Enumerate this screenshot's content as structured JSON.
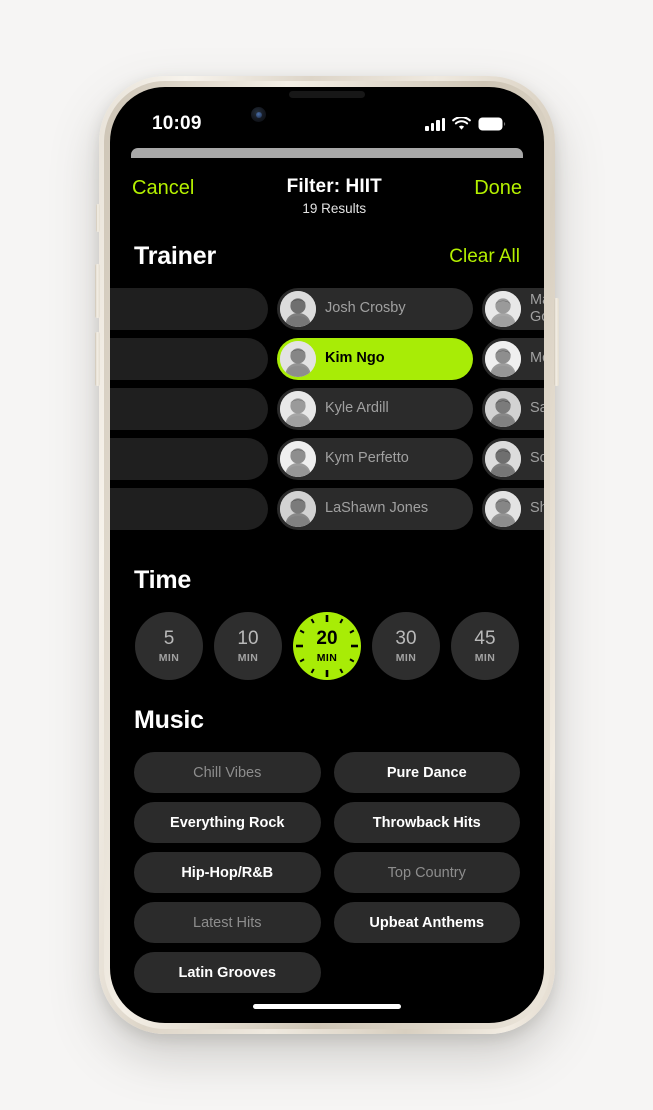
{
  "background_color": "#f6f5f4",
  "accent_color": "#a8ec06",
  "link_color": "#b4f000",
  "status_bar": {
    "time": "10:09",
    "cellular_icon": "cellular-signal-icon",
    "wifi_icon": "wifi-icon",
    "battery_icon": "battery-full-icon"
  },
  "nav": {
    "cancel_label": "Cancel",
    "title": "Filter: HIIT",
    "subtitle": "19 Results",
    "done_label": "Done"
  },
  "trainer": {
    "heading": "Trainer",
    "clear_all_label": "Clear All",
    "chips": [
      {
        "name": "",
        "selected": false,
        "ghost": true
      },
      {
        "name": "Josh Crosby",
        "selected": false,
        "ghost": false
      },
      {
        "name": "Marimba\nGold-Watts",
        "selected": false,
        "ghost": false
      },
      {
        "name": "",
        "selected": false,
        "ghost": true
      },
      {
        "name": "Kim Ngo",
        "selected": true,
        "ghost": false
      },
      {
        "name": "Molly Fox",
        "selected": false,
        "ghost": false
      },
      {
        "name": "",
        "selected": false,
        "ghost": true
      },
      {
        "name": "Kyle Ardill",
        "selected": false,
        "ghost": false
      },
      {
        "name": "Sam Sanchez",
        "selected": false,
        "ghost": false
      },
      {
        "name": "",
        "selected": false,
        "ghost": true
      },
      {
        "name": "Kym Perfetto",
        "selected": false,
        "ghost": false
      },
      {
        "name": "Scott Carvin",
        "selected": false,
        "ghost": false
      },
      {
        "name": "",
        "selected": false,
        "ghost": true
      },
      {
        "name": "LaShawn Jones",
        "selected": false,
        "ghost": false
      },
      {
        "name": "Sherica Holmon",
        "selected": false,
        "ghost": false
      }
    ]
  },
  "time": {
    "heading": "Time",
    "unit_label": "MIN",
    "options": [
      {
        "value": "5",
        "unit": "MIN",
        "selected": false
      },
      {
        "value": "10",
        "unit": "MIN",
        "selected": false
      },
      {
        "value": "20",
        "unit": "MIN",
        "selected": true
      },
      {
        "value": "30",
        "unit": "MIN",
        "selected": false
      },
      {
        "value": "45",
        "unit": "MIN",
        "selected": false
      }
    ]
  },
  "music": {
    "heading": "Music",
    "chips": [
      {
        "label": "Chill Vibes",
        "dim": true
      },
      {
        "label": "Pure Dance",
        "dim": false
      },
      {
        "label": "Everything Rock",
        "dim": false
      },
      {
        "label": "Throwback Hits",
        "dim": false
      },
      {
        "label": "Hip-Hop/R&B",
        "dim": false
      },
      {
        "label": "Top Country",
        "dim": true
      },
      {
        "label": "Latest Hits",
        "dim": true
      },
      {
        "label": "Upbeat Anthems",
        "dim": false
      },
      {
        "label": "Latin Grooves",
        "dim": false
      }
    ]
  },
  "hardware": {
    "speaker": "speaker-grille",
    "camera": "front-camera-icon",
    "mute_switch": "mute-switch",
    "volume_up": "volume-up-button",
    "volume_down": "volume-down-button",
    "power": "power-button",
    "home_indicator": "home-indicator"
  }
}
